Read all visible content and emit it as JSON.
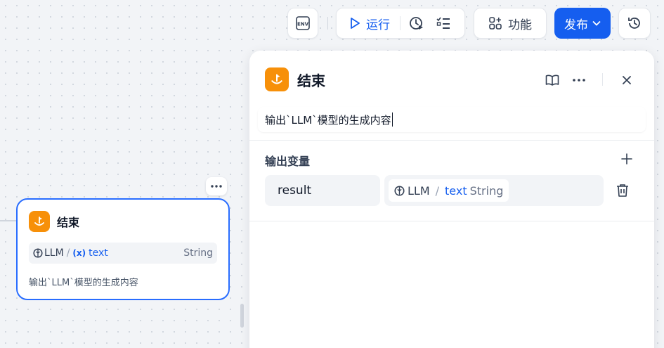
{
  "toolbar": {
    "env_label": "ENV",
    "run_label": "运行",
    "features_label": "功能",
    "publish_label": "发布"
  },
  "node": {
    "title": "结束",
    "var_source": "LLM",
    "var_name": "text",
    "var_type": "String",
    "description": "输出`LLM`模型的生成内容"
  },
  "panel": {
    "title": "结束",
    "description": "输出`LLM`模型的生成内容",
    "section_title": "输出变量",
    "variable_name": "result",
    "ref_source": "LLM",
    "ref_var": "text",
    "ref_type": "String"
  },
  "colors": {
    "accent": "#155eef",
    "node_icon": "#f79009",
    "selected_border": "#296dff"
  }
}
